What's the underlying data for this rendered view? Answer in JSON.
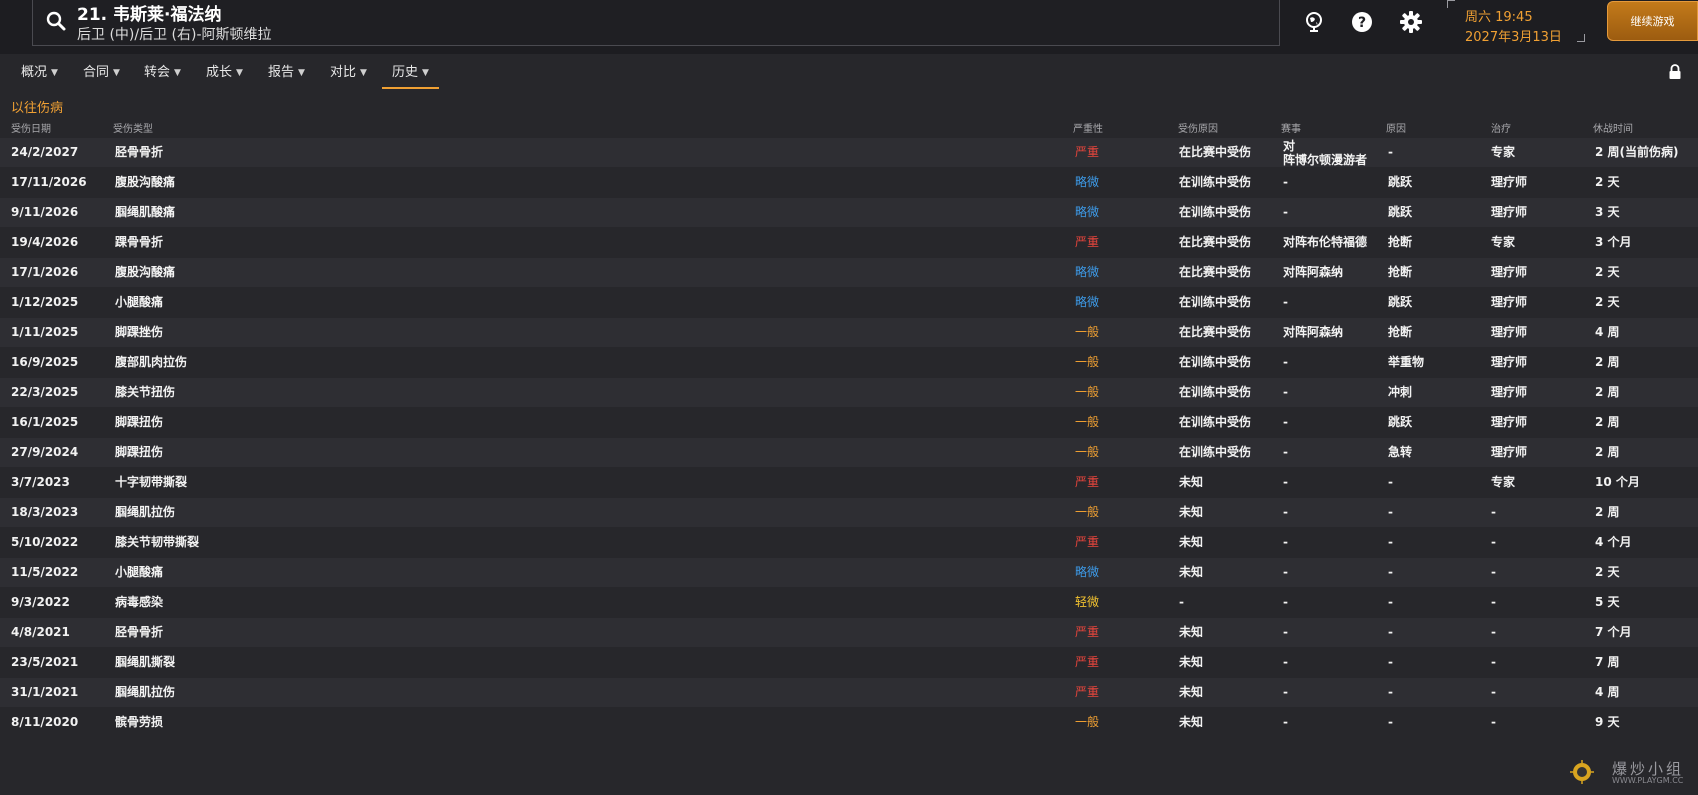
{
  "header": {
    "player_title": "21. 韦斯莱·福法纳",
    "player_positions": "后卫 (中)/后卫 (右)-阿斯顿维拉",
    "day_time": "周六 19:45",
    "date": "2027年3月13日",
    "continue_label": "继续游戏"
  },
  "tabs": [
    {
      "label": "概况"
    },
    {
      "label": "合同"
    },
    {
      "label": "转会"
    },
    {
      "label": "成长"
    },
    {
      "label": "报告"
    },
    {
      "label": "对比"
    },
    {
      "label": "历史"
    }
  ],
  "section_title": "以往伤病",
  "columns": {
    "date": "受伤日期",
    "type": "受伤类型",
    "severity": "严重性",
    "cause": "受伤原因",
    "match": "赛事",
    "reason": "原因",
    "treatment": "治疗",
    "downtime": "休战时间"
  },
  "injuries": [
    {
      "date": "24/2/2027",
      "type": "胫骨骨折",
      "severity": "严重",
      "cause": "在比赛中受伤",
      "match_line1": "对",
      "match_line2": "阵博尔顿漫游者",
      "reason": "-",
      "treatment": "专家",
      "downtime": "2 周(当前伤病)"
    },
    {
      "date": "17/11/2026",
      "type": "腹股沟酸痛",
      "severity": "略微",
      "cause": "在训练中受伤",
      "match": "-",
      "reason": "跳跃",
      "treatment": "理疗师",
      "downtime": "2 天"
    },
    {
      "date": "9/11/2026",
      "type": "腘绳肌酸痛",
      "severity": "略微",
      "cause": "在训练中受伤",
      "match": "-",
      "reason": "跳跃",
      "treatment": "理疗师",
      "downtime": "3 天"
    },
    {
      "date": "19/4/2026",
      "type": "踝骨骨折",
      "severity": "严重",
      "cause": "在比赛中受伤",
      "match": "对阵布伦特福德",
      "reason": "抢断",
      "treatment": "专家",
      "downtime": "3 个月"
    },
    {
      "date": "17/1/2026",
      "type": "腹股沟酸痛",
      "severity": "略微",
      "cause": "在比赛中受伤",
      "match": "对阵阿森纳",
      "reason": "抢断",
      "treatment": "理疗师",
      "downtime": "2 天"
    },
    {
      "date": "1/12/2025",
      "type": "小腿酸痛",
      "severity": "略微",
      "cause": "在训练中受伤",
      "match": "-",
      "reason": "跳跃",
      "treatment": "理疗师",
      "downtime": "2 天"
    },
    {
      "date": "1/11/2025",
      "type": "脚踝挫伤",
      "severity": "一般",
      "cause": "在比赛中受伤",
      "match": "对阵阿森纳",
      "reason": "抢断",
      "treatment": "理疗师",
      "downtime": "4 周"
    },
    {
      "date": "16/9/2025",
      "type": "腹部肌肉拉伤",
      "severity": "一般",
      "cause": "在训练中受伤",
      "match": "-",
      "reason": "举重物",
      "treatment": "理疗师",
      "downtime": "2 周"
    },
    {
      "date": "22/3/2025",
      "type": "膝关节扭伤",
      "severity": "一般",
      "cause": "在训练中受伤",
      "match": "-",
      "reason": "冲刺",
      "treatment": "理疗师",
      "downtime": "2 周"
    },
    {
      "date": "16/1/2025",
      "type": "脚踝扭伤",
      "severity": "一般",
      "cause": "在训练中受伤",
      "match": "-",
      "reason": "跳跃",
      "treatment": "理疗师",
      "downtime": "2 周"
    },
    {
      "date": "27/9/2024",
      "type": "脚踝扭伤",
      "severity": "一般",
      "cause": "在训练中受伤",
      "match": "-",
      "reason": "急转",
      "treatment": "理疗师",
      "downtime": "2 周"
    },
    {
      "date": "3/7/2023",
      "type": "十字韧带撕裂",
      "severity": "严重",
      "cause": "未知",
      "match": "-",
      "reason": "-",
      "treatment": "专家",
      "downtime": "10 个月"
    },
    {
      "date": "18/3/2023",
      "type": "腘绳肌拉伤",
      "severity": "一般",
      "cause": "未知",
      "match": "-",
      "reason": "-",
      "treatment": "-",
      "downtime": "2 周"
    },
    {
      "date": "5/10/2022",
      "type": "膝关节韧带撕裂",
      "severity": "严重",
      "cause": "未知",
      "match": "-",
      "reason": "-",
      "treatment": "-",
      "downtime": "4 个月"
    },
    {
      "date": "11/5/2022",
      "type": "小腿酸痛",
      "severity": "略微",
      "cause": "未知",
      "match": "-",
      "reason": "-",
      "treatment": "-",
      "downtime": "2 天"
    },
    {
      "date": "9/3/2022",
      "type": "病毒感染",
      "severity": "轻微",
      "cause": "-",
      "match": "-",
      "reason": "-",
      "treatment": "-",
      "downtime": "5 天"
    },
    {
      "date": "4/8/2021",
      "type": "胫骨骨折",
      "severity": "严重",
      "cause": "未知",
      "match": "-",
      "reason": "-",
      "treatment": "-",
      "downtime": "7 个月"
    },
    {
      "date": "23/5/2021",
      "type": "腘绳肌撕裂",
      "severity": "严重",
      "cause": "未知",
      "match": "-",
      "reason": "-",
      "treatment": "-",
      "downtime": "7 周"
    },
    {
      "date": "31/1/2021",
      "type": "腘绳肌拉伤",
      "severity": "严重",
      "cause": "未知",
      "match": "-",
      "reason": "-",
      "treatment": "-",
      "downtime": "4 周"
    },
    {
      "date": "8/11/2020",
      "type": "髌骨劳损",
      "severity": "一般",
      "cause": "未知",
      "match": "-",
      "reason": "-",
      "treatment": "-",
      "downtime": "9 天"
    }
  ],
  "watermark": {
    "text": "爆炒小组",
    "url": "WWW.PLAYGM.CC"
  },
  "colors": {
    "accent": "#f0a033",
    "severe": "#e8453c",
    "minor": "#3d9be9",
    "moderate": "#f0a033",
    "slight": "#f2c230"
  }
}
